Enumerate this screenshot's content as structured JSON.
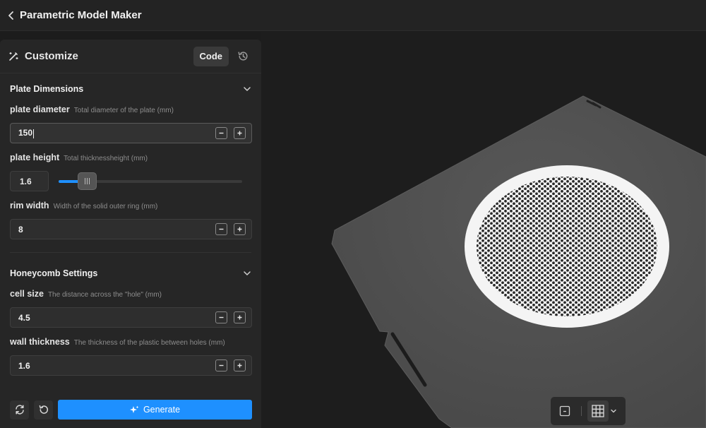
{
  "app": {
    "title": "Parametric Model Maker"
  },
  "panel": {
    "title": "Customize",
    "code_label": "Code"
  },
  "sections": {
    "plate": {
      "title": "Plate Dimensions",
      "diameter": {
        "name": "plate diameter",
        "desc": "Total diameter of the plate (mm)",
        "value": "150"
      },
      "height": {
        "name": "plate height",
        "desc": "Total thicknessheight (mm)",
        "value": "1.6",
        "slider_fraction": 0.155
      },
      "rim": {
        "name": "rim width",
        "desc": "Width of the solid outer ring (mm)",
        "value": "8"
      }
    },
    "honeycomb": {
      "title": "Honeycomb Settings",
      "cell": {
        "name": "cell size",
        "desc": "The distance across the \"hole\" (mm)",
        "value": "4.5"
      },
      "wall": {
        "name": "wall thickness",
        "desc": "The thickness of the plastic between holes (mm)",
        "value": "1.6"
      }
    }
  },
  "actions": {
    "generate_label": "Generate"
  },
  "colors": {
    "accent": "#1e90ff",
    "panel": "#262626",
    "viewport": "#1d1d1d"
  },
  "icons": [
    "chevron-left-icon",
    "magic-wand-icon",
    "history-icon",
    "chevron-down-icon",
    "minus-icon",
    "plus-icon",
    "refresh-icon",
    "undo-icon",
    "sparkle-icon",
    "box-view-icon",
    "grid-icon"
  ]
}
